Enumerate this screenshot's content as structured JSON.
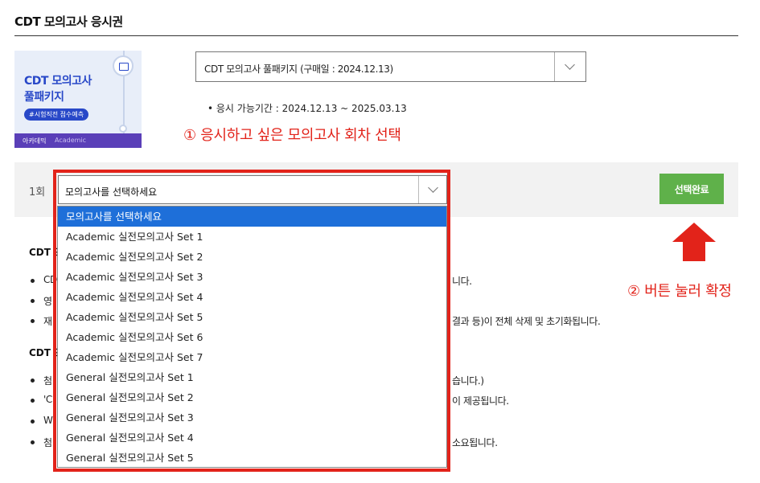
{
  "page": {
    "title": "CDT 모의고사 응시권"
  },
  "banner": {
    "title_line1": "CDT 모의고사",
    "title_line2": "풀패키지",
    "pill": "#시험직전 점수예측",
    "footer_brand": "아카데믹",
    "footer_sub": "Academic"
  },
  "package_select": {
    "value": "CDT 모의고사 풀패키지 (구매일 : 2024.12.13)"
  },
  "period": {
    "text": "• 응시 가능기간 : 2024.12.13 ~ 2025.03.13"
  },
  "annotations": {
    "step1": "① 응시하고 싶은 모의고사 회차 선택",
    "step2": "② 버튼 눌러 확정"
  },
  "round": {
    "label": "1회",
    "select_value": "모의고사를 선택하세요",
    "confirm_label": "선택완료"
  },
  "dropdown": {
    "options": [
      "모의고사를 선택하세요",
      "Academic 실전모의고사 Set 1",
      "Academic 실전모의고사 Set 2",
      "Academic 실전모의고사 Set 3",
      "Academic 실전모의고사 Set 4",
      "Academic 실전모의고사 Set 5",
      "Academic 실전모의고사 Set 6",
      "Academic 실전모의고사 Set 7",
      "General 실전모의고사 Set 1",
      "General 실전모의고사 Set 2",
      "General 실전모의고사 Set 3",
      "General 실전모의고사 Set 4",
      "General 실전모의고사 Set 5"
    ],
    "selected_index": 0
  },
  "notes": {
    "heading1": "CDT 모",
    "b1_start": "CD",
    "b1_end": "니다.",
    "b2_start": "영",
    "b3_start": "재",
    "b3_end": "결과 등)이 전체 삭제 및 초기화됩니다.",
    "heading2": "CDT 모",
    "b4_start": "첨",
    "b4_end": "습니다.)",
    "b5_start": "'C",
    "b5_end": "이 제공됩니다.",
    "b6_start": "W",
    "b7_start": "첨",
    "b7_end": "소요됩니다."
  },
  "colors": {
    "highlight_red": "#e2231a",
    "confirm_green": "#5fb14a",
    "selected_blue": "#1e6fd9"
  }
}
